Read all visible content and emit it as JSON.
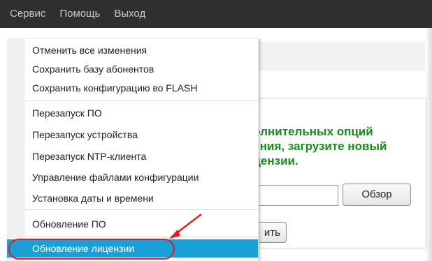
{
  "menubar": {
    "items": [
      "Сервис",
      "Помощь",
      "Выход"
    ]
  },
  "dropdown": {
    "items": [
      "Отменить все изменения",
      "Сохранить базу абонентов",
      "Сохранить конфигурацию во FLASH",
      "Перезапуск ПО",
      "Перезапуск устройства",
      "Перезапуск NTP-клиента",
      "Управление файлами конфигурации",
      "Установка даты и времени",
      "Обновление ПО",
      "Обновление лицензии"
    ],
    "highlighted": "Обновление лицензии"
  },
  "page": {
    "message_lines": [
      "полнительных опций",
      "нения, загрузите новый",
      "ицензии."
    ],
    "browse_button": "Обзор",
    "submit_button": "ить"
  },
  "colors": {
    "menubar_bg": "#2f2f2f",
    "highlight": "#1aa0d6",
    "message": "#1a8a1a",
    "annotation": "#e01e1e"
  }
}
